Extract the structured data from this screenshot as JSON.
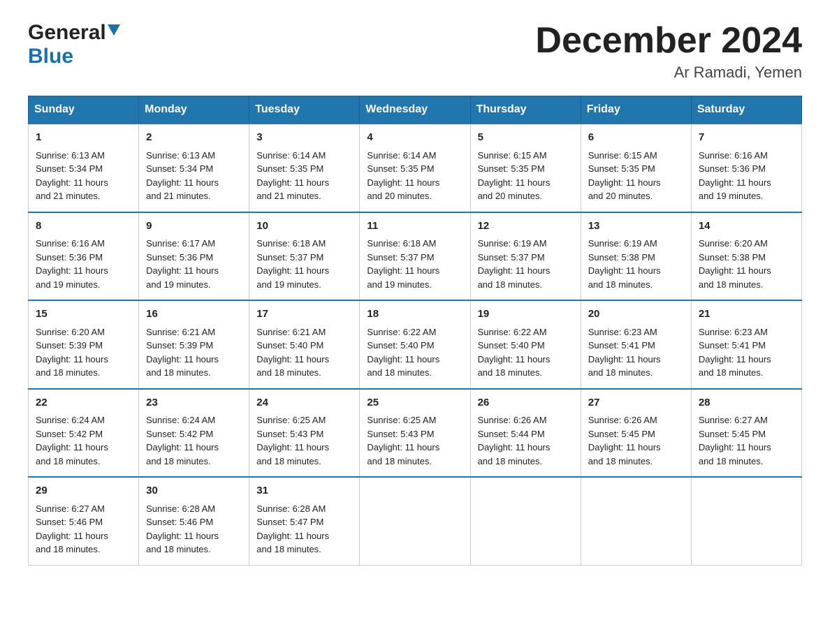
{
  "header": {
    "logo_general": "General",
    "logo_blue": "Blue",
    "month_title": "December 2024",
    "location": "Ar Ramadi, Yemen"
  },
  "weekdays": [
    "Sunday",
    "Monday",
    "Tuesday",
    "Wednesday",
    "Thursday",
    "Friday",
    "Saturday"
  ],
  "weeks": [
    [
      {
        "day": "1",
        "sunrise": "6:13 AM",
        "sunset": "5:34 PM",
        "daylight": "11 hours and 21 minutes."
      },
      {
        "day": "2",
        "sunrise": "6:13 AM",
        "sunset": "5:34 PM",
        "daylight": "11 hours and 21 minutes."
      },
      {
        "day": "3",
        "sunrise": "6:14 AM",
        "sunset": "5:35 PM",
        "daylight": "11 hours and 21 minutes."
      },
      {
        "day": "4",
        "sunrise": "6:14 AM",
        "sunset": "5:35 PM",
        "daylight": "11 hours and 20 minutes."
      },
      {
        "day": "5",
        "sunrise": "6:15 AM",
        "sunset": "5:35 PM",
        "daylight": "11 hours and 20 minutes."
      },
      {
        "day": "6",
        "sunrise": "6:15 AM",
        "sunset": "5:35 PM",
        "daylight": "11 hours and 20 minutes."
      },
      {
        "day": "7",
        "sunrise": "6:16 AM",
        "sunset": "5:36 PM",
        "daylight": "11 hours and 19 minutes."
      }
    ],
    [
      {
        "day": "8",
        "sunrise": "6:16 AM",
        "sunset": "5:36 PM",
        "daylight": "11 hours and 19 minutes."
      },
      {
        "day": "9",
        "sunrise": "6:17 AM",
        "sunset": "5:36 PM",
        "daylight": "11 hours and 19 minutes."
      },
      {
        "day": "10",
        "sunrise": "6:18 AM",
        "sunset": "5:37 PM",
        "daylight": "11 hours and 19 minutes."
      },
      {
        "day": "11",
        "sunrise": "6:18 AM",
        "sunset": "5:37 PM",
        "daylight": "11 hours and 19 minutes."
      },
      {
        "day": "12",
        "sunrise": "6:19 AM",
        "sunset": "5:37 PM",
        "daylight": "11 hours and 18 minutes."
      },
      {
        "day": "13",
        "sunrise": "6:19 AM",
        "sunset": "5:38 PM",
        "daylight": "11 hours and 18 minutes."
      },
      {
        "day": "14",
        "sunrise": "6:20 AM",
        "sunset": "5:38 PM",
        "daylight": "11 hours and 18 minutes."
      }
    ],
    [
      {
        "day": "15",
        "sunrise": "6:20 AM",
        "sunset": "5:39 PM",
        "daylight": "11 hours and 18 minutes."
      },
      {
        "day": "16",
        "sunrise": "6:21 AM",
        "sunset": "5:39 PM",
        "daylight": "11 hours and 18 minutes."
      },
      {
        "day": "17",
        "sunrise": "6:21 AM",
        "sunset": "5:40 PM",
        "daylight": "11 hours and 18 minutes."
      },
      {
        "day": "18",
        "sunrise": "6:22 AM",
        "sunset": "5:40 PM",
        "daylight": "11 hours and 18 minutes."
      },
      {
        "day": "19",
        "sunrise": "6:22 AM",
        "sunset": "5:40 PM",
        "daylight": "11 hours and 18 minutes."
      },
      {
        "day": "20",
        "sunrise": "6:23 AM",
        "sunset": "5:41 PM",
        "daylight": "11 hours and 18 minutes."
      },
      {
        "day": "21",
        "sunrise": "6:23 AM",
        "sunset": "5:41 PM",
        "daylight": "11 hours and 18 minutes."
      }
    ],
    [
      {
        "day": "22",
        "sunrise": "6:24 AM",
        "sunset": "5:42 PM",
        "daylight": "11 hours and 18 minutes."
      },
      {
        "day": "23",
        "sunrise": "6:24 AM",
        "sunset": "5:42 PM",
        "daylight": "11 hours and 18 minutes."
      },
      {
        "day": "24",
        "sunrise": "6:25 AM",
        "sunset": "5:43 PM",
        "daylight": "11 hours and 18 minutes."
      },
      {
        "day": "25",
        "sunrise": "6:25 AM",
        "sunset": "5:43 PM",
        "daylight": "11 hours and 18 minutes."
      },
      {
        "day": "26",
        "sunrise": "6:26 AM",
        "sunset": "5:44 PM",
        "daylight": "11 hours and 18 minutes."
      },
      {
        "day": "27",
        "sunrise": "6:26 AM",
        "sunset": "5:45 PM",
        "daylight": "11 hours and 18 minutes."
      },
      {
        "day": "28",
        "sunrise": "6:27 AM",
        "sunset": "5:45 PM",
        "daylight": "11 hours and 18 minutes."
      }
    ],
    [
      {
        "day": "29",
        "sunrise": "6:27 AM",
        "sunset": "5:46 PM",
        "daylight": "11 hours and 18 minutes."
      },
      {
        "day": "30",
        "sunrise": "6:28 AM",
        "sunset": "5:46 PM",
        "daylight": "11 hours and 18 minutes."
      },
      {
        "day": "31",
        "sunrise": "6:28 AM",
        "sunset": "5:47 PM",
        "daylight": "11 hours and 18 minutes."
      },
      null,
      null,
      null,
      null
    ]
  ],
  "labels": {
    "sunrise": "Sunrise:",
    "sunset": "Sunset:",
    "daylight": "Daylight:"
  }
}
